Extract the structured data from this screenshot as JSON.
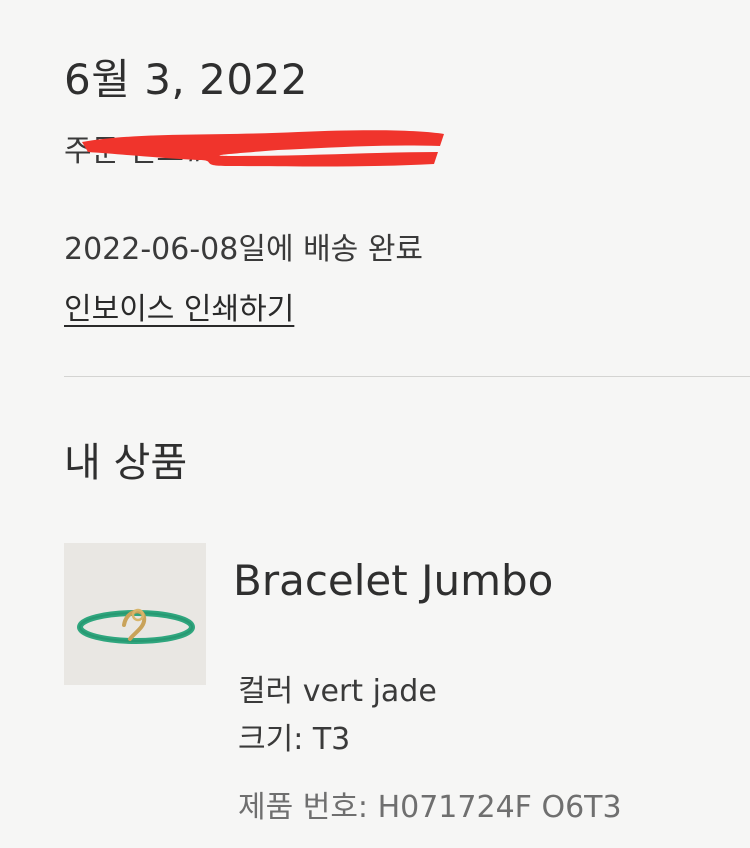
{
  "order": {
    "date": "6월 3, 2022",
    "number_label": "주문 번호#",
    "delivery_status": "2022-06-08일에 배송 완료",
    "print_invoice_label": "인보이스 인쇄하기"
  },
  "products_section": {
    "title": "내 상품"
  },
  "product": {
    "name": "Bracelet Jumbo",
    "color_line": "컬러 vert jade",
    "size_line": "크기: T3",
    "ref_line": "제품 번호: H071724F O6T3",
    "thumbnail_icon": "green-cord-bracelet-image"
  },
  "colors": {
    "redaction": "#f0342c",
    "bracelet_cord": "#2fa67e",
    "bracelet_clasp": "#c9a35a"
  }
}
